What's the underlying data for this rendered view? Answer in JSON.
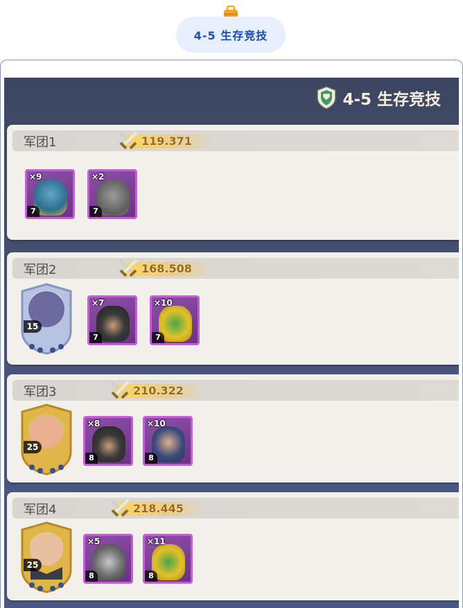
{
  "header": {
    "badge_label": "4-5 生存竞技"
  },
  "game": {
    "title": "4-5 生存竞技",
    "teams": [
      {
        "name": "军团1",
        "power": "119.371",
        "units": [
          {
            "count": "×9",
            "level": "7"
          },
          {
            "count": "×2",
            "level": "7"
          }
        ]
      },
      {
        "name": "军团2",
        "power": "168.508",
        "hero_level": "15",
        "units": [
          {
            "count": "×7",
            "level": "7"
          },
          {
            "count": "×10",
            "level": "7"
          }
        ]
      },
      {
        "name": "军团3",
        "power": "210.322",
        "hero_level": "25",
        "units": [
          {
            "count": "×8",
            "level": "8"
          },
          {
            "count": "×10",
            "level": "8"
          }
        ]
      },
      {
        "name": "军团4",
        "power": "218.445",
        "hero_level": "25",
        "units": [
          {
            "count": "×5",
            "level": "8"
          },
          {
            "count": "×11",
            "level": "8"
          }
        ]
      }
    ]
  },
  "colors": {
    "accent": "#1a4ea8",
    "pill_bg": "#e6efff",
    "unit_border": "#c55cd8",
    "power_text": "#9a6a1c",
    "game_bg": "#49557a"
  },
  "icons": {
    "header": "clipboard-icon",
    "title": "shield-icon",
    "power": "crossed-swords-icon"
  }
}
